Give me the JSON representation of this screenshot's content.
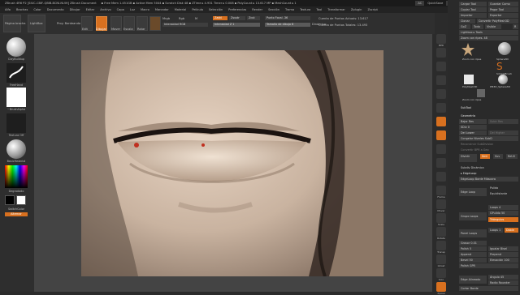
{
  "titlebar": {
    "app": "ZBrush 4R6 P2 [SIUC-CBIF-QBIB-BCNI-NUIH] ZBrush Document",
    "free_mem": "▪ Free Mem 1.451GB ▪ Active Mem 5044 ▪ Scratch Disk 48 ▪ ZTime ▸ 4.931 Timer ▸ 0.008 ▪ PolyCount ▸ 13.617 MP ▪ MeshCount ▸ 1",
    "btn_ac": "AC",
    "quicksave": "QuickSave",
    "transp": "Transparente 0",
    "menus_btn": "Menús",
    "defscript": "DefaultZScript"
  },
  "menubar": {
    "items": [
      "Alfa",
      "Brochas",
      "Color",
      "Documento",
      "Dibujar",
      "Editar",
      "Archivo",
      "Capa",
      "Luz",
      "Macro",
      "Marcador",
      "Material",
      "Película",
      "Selección",
      "Preferencias",
      "Render",
      "Sección",
      "Trama",
      "Textura",
      "Tool",
      "Transformar",
      "Zplugin",
      "Zscript"
    ]
  },
  "toolbar": {
    "lightbox": "LightBox",
    "page_brush": "Página brocha",
    "proy": "Proy. Bordeando",
    "edit": "Edit",
    "draw": "Dibujar",
    "move": "Mover",
    "scale": "Escala",
    "rotate": "Rotar",
    "mrgb": "Mrgb",
    "rgb": "Rgb",
    "m": "M",
    "zadd": "Zadd",
    "zsub": "Zsustr",
    "zcut": "Zcut",
    "rgb_int": "Intensidad RGB",
    "z_int": "Intensidad Z 1",
    "focal": "Punto Focal -36",
    "draw_size": "Tamaño de dibujo 8",
    "dynamic": "Dinámico",
    "active_points": "Cuenta de Puntos Actuais: 13.617",
    "total_points": "Cuenta de Puntos Totales: 13.493"
  },
  "leftpanel": {
    "brush1": "ClayBuildup",
    "brush2": "FreeHand",
    "alpha": "~BrushAlpha",
    "texture": "Textura Off",
    "material": "BasicMaterial",
    "gradient": "Degradado",
    "switch": "SwitchColor",
    "alt": "Alternar"
  },
  "rightstrip": {
    "labels": [
      "BPR",
      "SPix 3",
      "",
      "Retroc.",
      "",
      "Real",
      "",
      "AAHalf",
      "",
      "Persp",
      "",
      "Piso",
      "",
      "Local",
      "",
      "L.Sym",
      "",
      "XYZ",
      "",
      "",
      "",
      "",
      "Frame",
      "",
      "Mover",
      "",
      "Scale",
      "",
      "Rotate",
      "",
      "Transp",
      "",
      "Ghost",
      "",
      "Solo",
      "",
      "Xpose"
    ]
  },
  "rightpanel": {
    "top_btns": [
      "Cargar Tool",
      "Guardar Como"
    ],
    "r2": [
      "Copiar Tool",
      "Pegar Tool"
    ],
    "r3": [
      "Importar",
      "Exportar"
    ],
    "r4": [
      "Clonar",
      "Convertir PolyMesh3D"
    ],
    "r5": [
      "GoZ",
      "Todo",
      "Visible",
      "R"
    ],
    "lightbox_tools": "Lightbox ▸ Tools",
    "zoom_label": "Zoom con ripes. 48",
    "thumbs": [
      "Zoom con ripes",
      "Sphere3D",
      "SimpleBrush",
      "PolyMesh3D",
      "PM3D_Sphere3D",
      "Zoom con ripes"
    ],
    "subtool": "SubTool",
    "geometry": "Geometría",
    "lower_res": "Bajar Res",
    "higher_res": "Subir Res",
    "sdiv": "SDiv 0",
    "del_lower": "Del Lower",
    "del_higher": "Del Higher",
    "freeze": "Congelar Niveles SubD",
    "reconstruct": "Reconstruir SubDivision",
    "convert_bpr": "Convertir BPR a Geo",
    "divide": "Dividir",
    "smt": "Smt",
    "suv": "Suv",
    "rsmt": "ReUV",
    "dynamic_subdiv": "Subdiv Dinámica",
    "edgeloop": "▸ EdgeLoop",
    "edgeloop_mask": "EdgeLoop Borde Máscara",
    "edge_loop": "Edge Loop",
    "polish": "Pulido",
    "equidist": "Equidistante",
    "loops": "Loops 4",
    "grupo_loops": "Grupo Loops",
    "gpulido": "GPulido 50",
    "triangulos": "Triángulos",
    "panel_loops": "Panel Loops",
    "loops2": "Loops 1",
    "doble": "Doble",
    "grosor": "Grosor 0.01",
    "polish2": "Polish 5",
    "igualar": "Igualar Bisel",
    "elevacion": "Elevación 100",
    "polish_gpr": "Polish GPR",
    "append": "Append",
    "prepend": "Prepend",
    "keep": "Mantener Rango",
    "aligned": "Alinear Lanes",
    "bevel": "Bevel 50",
    "polycount": "Polycount 13.617",
    "rel_loops": "Relax Loops",
    "edge_aligned": "Edge Alineado",
    "angulo": "Ángulo 45",
    "radio": "Radio Rounder",
    "cortar": "Cortar Borde",
    "ajustar": "Ajustar 0"
  },
  "colors": {
    "accent": "#d8701f",
    "panel": "#2a2a2a",
    "skin_light": "#d9c3b0",
    "skin_dark": "#3a2e28"
  }
}
